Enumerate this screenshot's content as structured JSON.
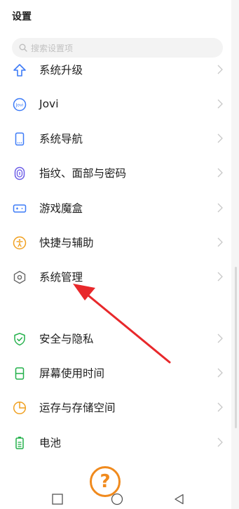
{
  "header": {
    "title": "设置"
  },
  "search": {
    "placeholder": "搜索设置项"
  },
  "items": [
    {
      "label": "系统升级",
      "icon": "upgrade-arrow-icon",
      "color": "#3d7bf7"
    },
    {
      "label": "Jovi",
      "icon": "jovi-icon",
      "color": "#3d7bf7"
    },
    {
      "label": "系统导航",
      "icon": "phone-navigation-icon",
      "color": "#3d7bf7"
    },
    {
      "label": "指纹、面部与密码",
      "icon": "fingerprint-icon",
      "color": "#6b5ce7"
    },
    {
      "label": "游戏魔盒",
      "icon": "gamepad-icon",
      "color": "#3d7bf7"
    },
    {
      "label": "快捷与辅助",
      "icon": "accessibility-icon",
      "color": "#f0a020"
    },
    {
      "label": "系统管理",
      "icon": "hexagon-settings-icon",
      "color": "#666666"
    },
    {
      "label": "安全与隐私",
      "icon": "shield-check-icon",
      "color": "#22b04a"
    },
    {
      "label": "屏幕使用时间",
      "icon": "hourglass-icon",
      "color": "#22b04a"
    },
    {
      "label": "运存与存储空间",
      "icon": "pie-storage-icon",
      "color": "#f0a020"
    },
    {
      "label": "电池",
      "icon": "battery-icon",
      "color": "#22b04a"
    }
  ],
  "help_button": {
    "symbol": "?"
  },
  "accent": {
    "arrow": "#e8282b",
    "help": "#f08a1d"
  }
}
